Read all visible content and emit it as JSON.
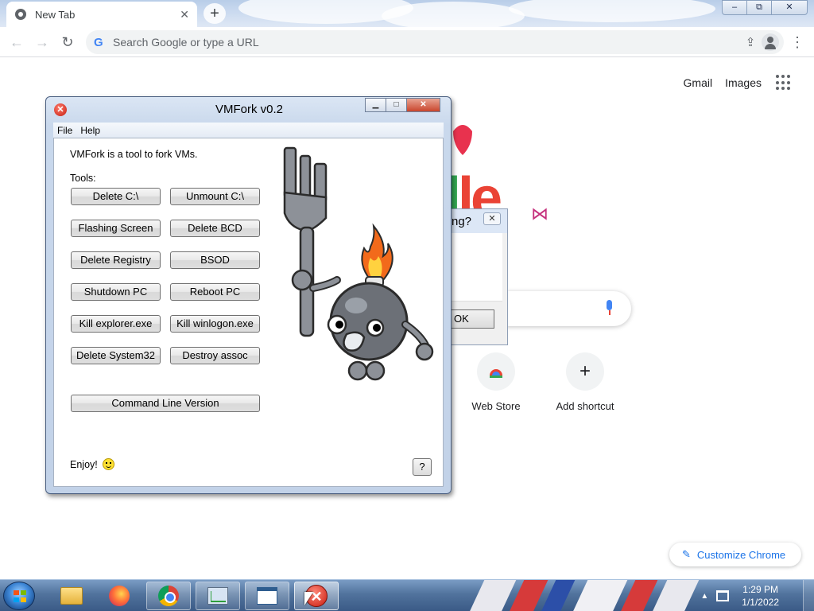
{
  "browser": {
    "tab_title": "New Tab",
    "tab_close_glyph": "✕",
    "new_tab_glyph": "+",
    "window_controls": [
      "‒",
      "⧉",
      "✕"
    ],
    "omnibox_placeholder": "Search Google or type a URL",
    "omnibox_logo": "G",
    "icons": [
      "back-arrow-icon",
      "forward-arrow-icon",
      "reload-icon",
      "share-icon",
      "star-icon",
      "profile-icon",
      "menu-icon"
    ]
  },
  "ntp": {
    "links": {
      "gmail": "Gmail",
      "images": "Images"
    },
    "doodle_text": "le",
    "shortcuts": [
      {
        "label": "Web Store",
        "icon": "webstore-icon"
      },
      {
        "label": "Add shortcut",
        "icon": "plus-icon",
        "glyph": "+"
      }
    ],
    "customize_label": "Customize Chrome",
    "customize_icon": "✎"
  },
  "msgbox": {
    "title_fragment": "ng?",
    "close_glyph": "✕",
    "ok_label": "OK"
  },
  "vmfork": {
    "title": "VMFork v0.2",
    "close_glyph": "✕",
    "menu": {
      "file": "File",
      "help": "Help"
    },
    "description": "VMFork is a tool to fork VMs.",
    "tools_label": "Tools:",
    "buttons": [
      "Delete C:\\",
      "Unmount C:\\",
      "Flashing Screen",
      "Delete BCD",
      "Delete Registry",
      "BSOD",
      "Shutdown PC",
      "Reboot PC",
      "Kill explorer.exe",
      "Kill winlogon.exe",
      "Delete System32",
      "Destroy assoc"
    ],
    "cmdline_label": "Command Line Version",
    "enjoy_label": "Enjoy!",
    "help_button": "?"
  },
  "taskbar": {
    "items": [
      "folder-icon",
      "firefox-icon",
      "chrome-icon",
      "task-manager-icon",
      "app-window-icon",
      "red-x-icon"
    ],
    "redx_glyph": "✕",
    "clock_time": "1:29 PM",
    "clock_date": "1/1/2022",
    "tray_arrow": "▲"
  },
  "colors": {
    "chrome_blue": "#1a73e8",
    "taskbar": "#51739d",
    "vm_frame": "#c9d8ec"
  }
}
